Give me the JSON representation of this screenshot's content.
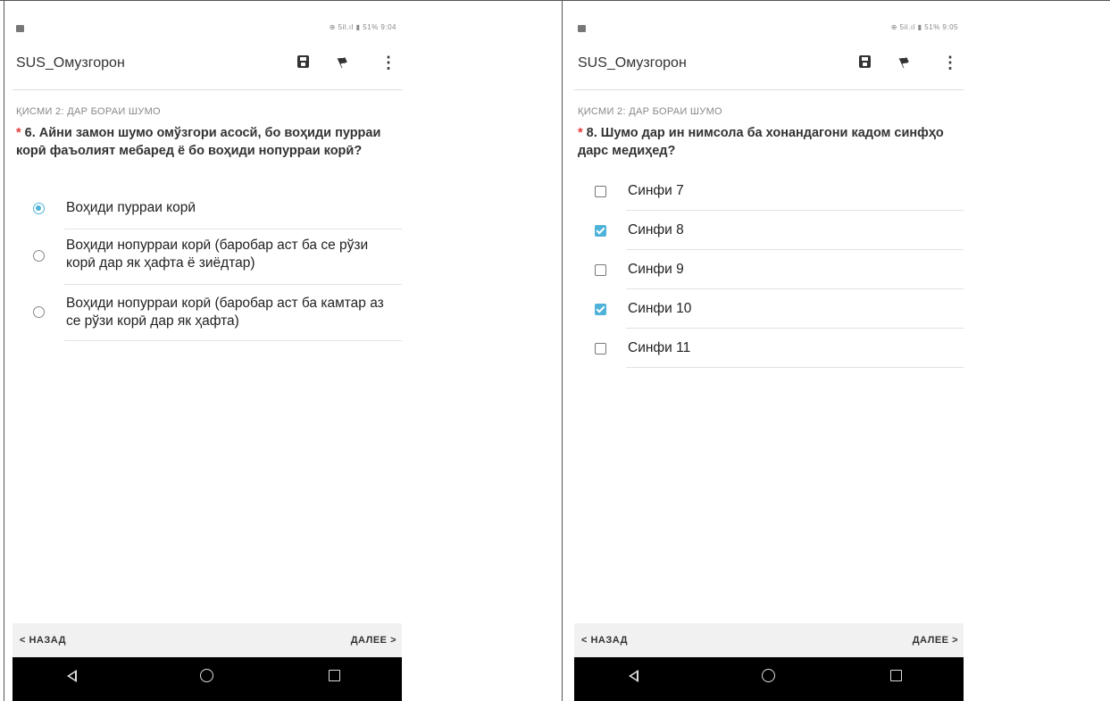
{
  "colors": {
    "accent": "#4fb3d9",
    "required": "#e53935",
    "nav_bg": "#f1f1f1",
    "system_bar": "#000000"
  },
  "left": {
    "status": {
      "right_text": "⊕ 5il.ıl ▮ 51% 9:04"
    },
    "app": {
      "title": "SUS_Омузгорон",
      "save_icon": "save-icon",
      "flag_icon": "flag-icon",
      "more_icon": "more-vert-icon"
    },
    "section": "ҚИСМИ 2: ДАР БОРАИ ШУМО",
    "question": {
      "required_mark": "* ",
      "text": "6. Айни замон шумо омўзгори асосй, бо воҳиди пурраи корӣ фаъолият мебаред ё бо воҳиди нопурраи корӣ?"
    },
    "type": "single-choice",
    "options": [
      {
        "label": "Воҳиди пурраи корӣ",
        "selected": true
      },
      {
        "label": "Воҳиди нопурраи корӣ (баробар аст ба се рўзи корӣ дар як ҳафта ё зиёдтар)",
        "selected": false
      },
      {
        "label": "Воҳиди нопурраи корӣ (баробар аст ба камтар аз се рўзи корӣ дар як ҳафта)",
        "selected": false
      }
    ],
    "nav": {
      "back": "< НАЗАД",
      "next": "ДАЛЕЕ >"
    }
  },
  "right": {
    "status": {
      "right_text": "⊕ 5il.ıl ▮ 51% 9:05"
    },
    "app": {
      "title": "SUS_Омузгорон",
      "save_icon": "save-icon",
      "flag_icon": "flag-icon",
      "more_icon": "more-vert-icon"
    },
    "section": "ҚИСМИ 2: ДАР БОРАИ ШУМО",
    "question": {
      "required_mark": "* ",
      "text": "8. Шумо дар ин нимсола ба хонандагони кадом синфҳо дарс медиҳед?"
    },
    "type": "multi-choice",
    "options": [
      {
        "label": "Синфи 7",
        "selected": false
      },
      {
        "label": "Синфи 8",
        "selected": true
      },
      {
        "label": "Синфи 9",
        "selected": false
      },
      {
        "label": "Синфи 10",
        "selected": true
      },
      {
        "label": "Синфи 11",
        "selected": false
      }
    ],
    "nav": {
      "back": "< НАЗАД",
      "next": "ДАЛЕЕ >"
    }
  },
  "system_nav": {
    "back_icon": "triangle-back-icon",
    "home_icon": "circle-home-icon",
    "recents_icon": "square-recents-icon"
  }
}
